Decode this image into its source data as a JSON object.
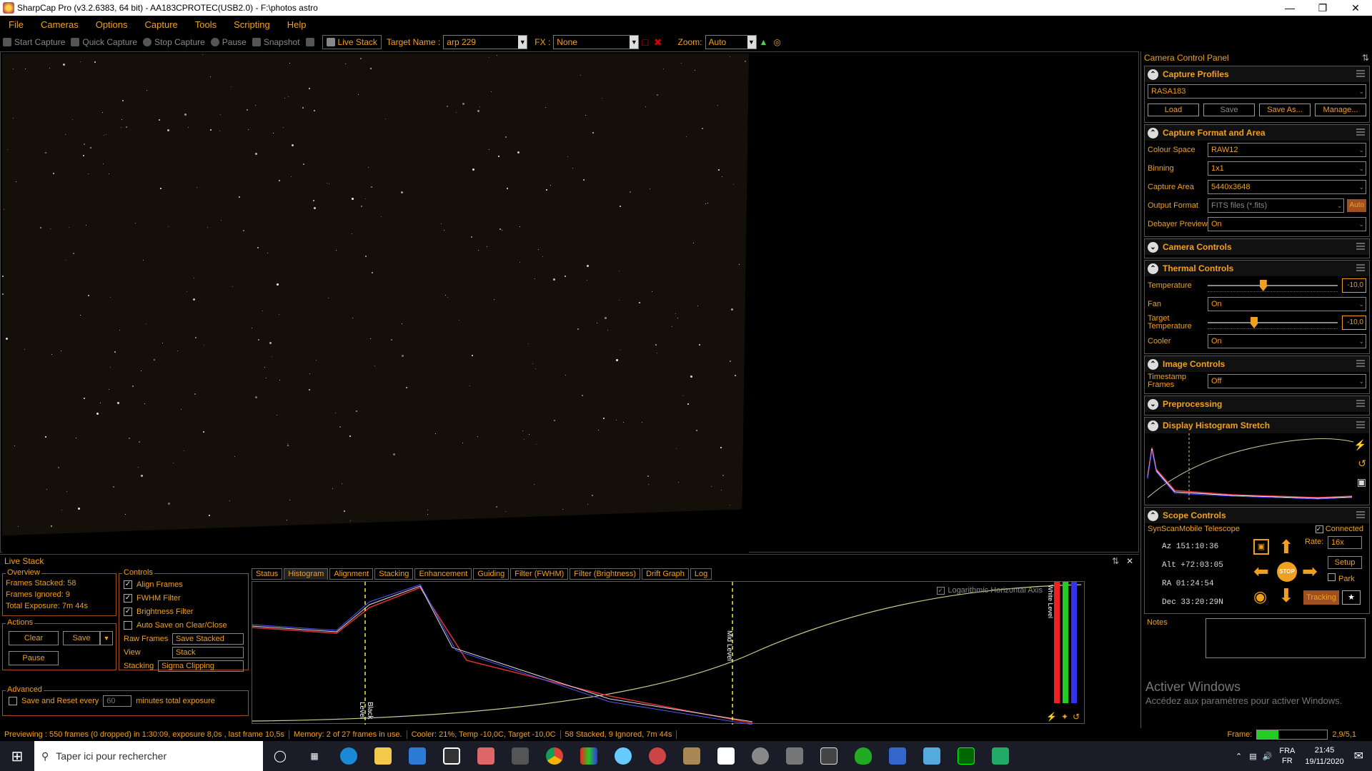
{
  "title": "SharpCap Pro (v3.2.6383, 64 bit) - AA183CPROTEC(USB2.0) - F:\\photos astro",
  "menu": [
    "File",
    "Cameras",
    "Options",
    "Capture",
    "Tools",
    "Scripting",
    "Help"
  ],
  "toolbar": {
    "start": "Start Capture",
    "quick": "Quick Capture",
    "stop": "Stop Capture",
    "pause": "Pause",
    "snapshot": "Snapshot",
    "live": "Live Stack",
    "target_label": "Target Name :",
    "target_value": "arp 229",
    "fx_label": "FX :",
    "fx_value": "None",
    "zoom_label": "Zoom:",
    "zoom_value": "Auto"
  },
  "panel": {
    "title": "Camera Control Panel",
    "profiles": {
      "title": "Capture Profiles",
      "value": "RASA183",
      "load": "Load",
      "save": "Save",
      "saveas": "Save As...",
      "manage": "Manage..."
    },
    "format": {
      "title": "Capture Format and Area",
      "colour_label": "Colour Space",
      "colour": "RAW12",
      "binning_label": "Binning",
      "binning": "1x1",
      "area_label": "Capture Area",
      "area": "5440x3648",
      "output_label": "Output Format",
      "output": "FITS files (*.fits)",
      "auto": "Auto",
      "debayer_label": "Debayer Preview",
      "debayer": "On"
    },
    "camera": "Camera Controls",
    "thermal": {
      "title": "Thermal Controls",
      "temp_label": "Temperature",
      "temp": "-10,0",
      "temp_level": 0.4,
      "fan_label": "Fan",
      "fan": "On",
      "target_label": "Target Temperature",
      "target": "-10,0",
      "target_level": 0.33,
      "cooler_label": "Cooler",
      "cooler": "On"
    },
    "image": {
      "title": "Image Controls",
      "ts_label": "Timestamp Frames",
      "ts": "Off"
    },
    "pre": "Preprocessing",
    "hist": "Display Histogram Stretch",
    "scope": {
      "title": "Scope Controls",
      "name": "SynScanMobile Telescope",
      "connected": "Connected",
      "az": "Az  151:10:36",
      "alt": "Alt +72:03:05",
      "ra": "RA  01:24:54",
      "dec": "Dec 33:20:29N",
      "rate_label": "Rate:",
      "rate": "16x",
      "setup": "Setup",
      "park": "Park",
      "tracking": "Tracking",
      "stop": "STOP"
    },
    "notes": "Notes"
  },
  "live": {
    "title": "Live Stack",
    "overview": "Overview",
    "stacked": "Frames Stacked: 58",
    "ignored": "Frames Ignored:  9",
    "exposure": "Total Exposure:   7m 44s",
    "actions": "Actions",
    "clear": "Clear",
    "save": "Save",
    "pause": "Pause",
    "controls": "Controls",
    "align": "Align Frames",
    "fwhm": "FWHM Filter",
    "bright": "Brightness Filter",
    "autosave": "Auto Save on Clear/Close",
    "raw_label": "Raw Frames",
    "raw": "Save Stacked",
    "view_label": "View",
    "view": "Stack",
    "stacking_label": "Stacking",
    "stacking": "Sigma Clipping",
    "advanced": "Advanced",
    "reset": "Save and Reset every",
    "minutes": "60",
    "minutes_label": "minutes total exposure",
    "tabs": [
      "Status",
      "Histogram",
      "Alignment",
      "Stacking",
      "Enhancement",
      "Guiding",
      "Filter (FWHM)",
      "Filter (Brightness)",
      "Drift Graph",
      "Log"
    ],
    "log_axis": "Logarithmic Horizontal Axis",
    "black": "Black Level",
    "mid": "Mid Level",
    "white": "White Level"
  },
  "status": [
    "Previewing : 550 frames (0 dropped) in 1:30:09, exposure 8,0s , last frame 10,5s",
    "Memory: 2 of 27 frames in use.",
    "Cooler: 21%, Temp -10,0C, Target -10,0C",
    "58 Stacked, 9 Ignored, 7m 44s"
  ],
  "frame": {
    "label": "Frame:",
    "value": "2,9/5,1"
  },
  "activate": {
    "line1": "Activer Windows",
    "line2": "Accédez aux paramètres pour activer Windows."
  },
  "taskbar": {
    "search": "Taper ici pour rechercher",
    "lang1": "FRA",
    "lang2": "FR",
    "time": "21:45",
    "date": "19/11/2020"
  }
}
